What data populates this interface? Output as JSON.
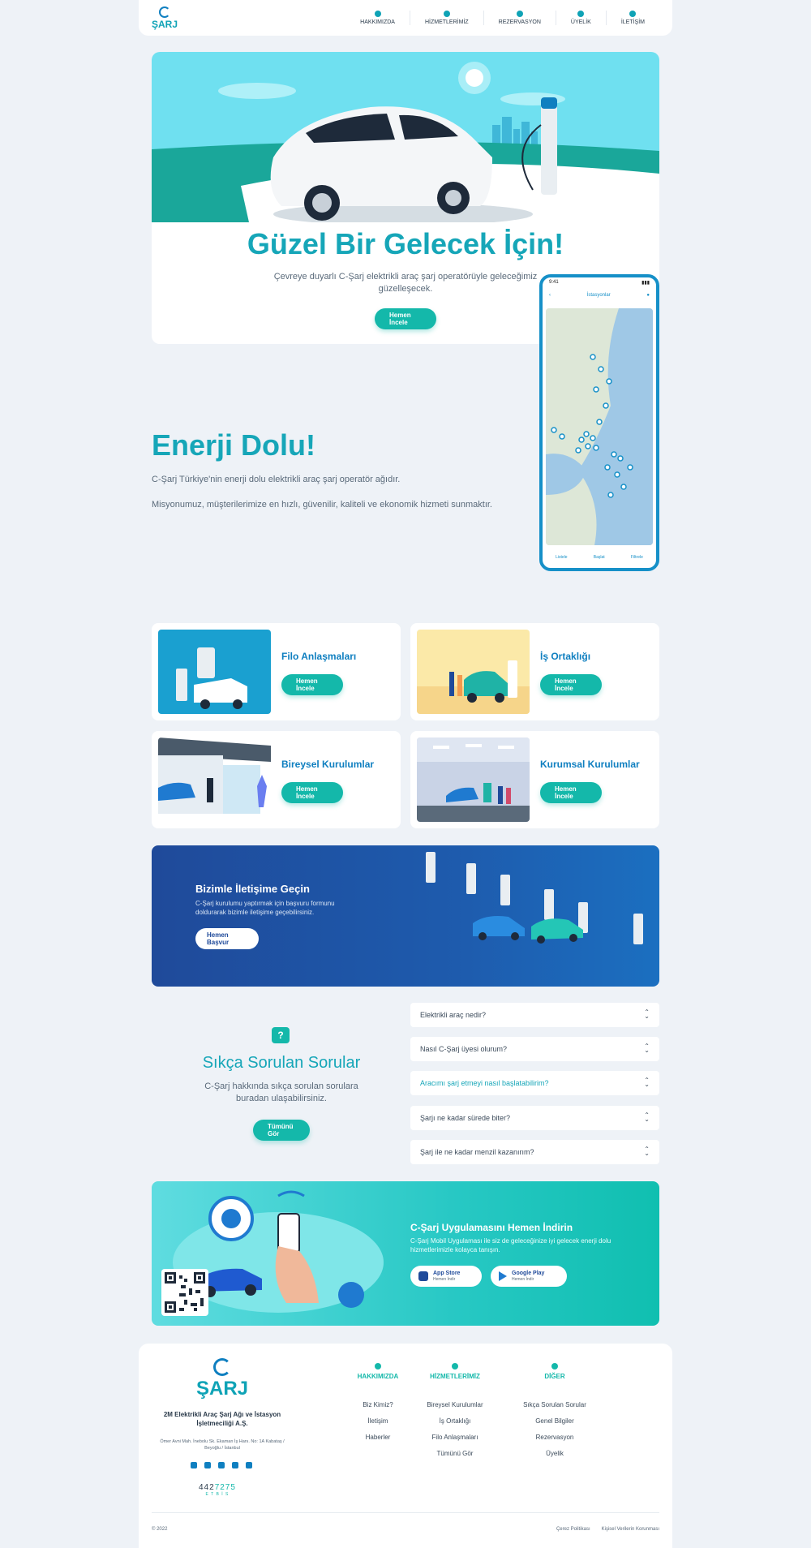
{
  "header": {
    "logo_text": "ŞARJ",
    "nav": [
      {
        "label": "HAKKIMIZDA",
        "icon": "cloud-icon"
      },
      {
        "label": "HİZMETLERİMİZ",
        "icon": "services-icon"
      },
      {
        "label": "REZERVASYON",
        "icon": "calendar-icon"
      },
      {
        "label": "ÜYELİK",
        "icon": "user-icon"
      },
      {
        "label": "İLETİŞİM",
        "icon": "mail-icon"
      }
    ]
  },
  "hero": {
    "title": "Güzel Bir Gelecek İçin!",
    "subtitle": "Çevreye duyarlı C-Şarj elektrikli araç şarj operatörüyle geleceğimiz güzelleşecek.",
    "button": "Hemen İncele"
  },
  "phone": {
    "time": "9:41",
    "screen_title": "İstasyonlar",
    "tabs": [
      "Listele",
      "Başlat",
      "Filtrele"
    ]
  },
  "energy": {
    "title": "Enerji Dolu!",
    "p1": "C-Şarj Türkiye'nin enerji dolu elektrikli araç şarj operatör ağıdır.",
    "p2": "Misyonumuz, müşterilerimize en hızlı, güvenilir, kaliteli ve ekonomik hizmeti sunmaktır."
  },
  "services": [
    {
      "title": "Filo Anlaşmaları",
      "button": "Hemen İncele"
    },
    {
      "title": "İş Ortaklığı",
      "button": "Hemen İncele"
    },
    {
      "title": "Bireysel Kurulumlar",
      "button": "Hemen İncele"
    },
    {
      "title": "Kurumsal Kurulumlar",
      "button": "Hemen İncele"
    }
  ],
  "contact": {
    "title": "Bizimle İletişime Geçin",
    "text": "C-Şarj kurulumu yaptırmak için başvuru formunu doldurarak bizimle iletişime geçebilirsiniz.",
    "button": "Hemen Başvur"
  },
  "faq": {
    "icon_glyph": "?",
    "title": "Sıkça Sorulan Sorular",
    "text": "C-Şarj hakkında sıkça sorulan sorulara buradan ulaşabilirsiniz.",
    "button": "Tümünü Gör",
    "items": [
      "Elektrikli araç nedir?",
      "Nasıl C-Şarj üyesi olurum?",
      "Aracımı şarj etmeyi nasıl başlatabilirim?",
      "Şarjı ne kadar sürede biter?",
      "Şarj ile ne kadar menzil kazanırım?"
    ],
    "active_index": 2
  },
  "app": {
    "title": "C-Şarj Uygulamasını Hemen İndirin",
    "text": "C-Şarj Mobil Uygulaması ile siz de geleceğinize iyi gelecek enerji dolu hizmetlerimizle kolayca tanışın.",
    "appstore_label": "App Store",
    "appstore_sub": "Hemen İndir",
    "googleplay_label": "Google Play",
    "googleplay_sub": "Hemen İndir"
  },
  "footer": {
    "logo_text": "ŞARJ",
    "company": "2M Elektrikli Araç Şarj Ağı ve İstasyon İşletmeciliği A.Ş.",
    "address": "Ömer Avni Mah. İnebolu Sk. Ekaman İş Hanı. No: 1A Kabataş / Beyoğlu / İstanbul",
    "etbis_number": "4427275",
    "etbis_black": "442",
    "etbis_teal": "7275",
    "etbis_label": "E T B İ S",
    "columns": [
      {
        "heading": "HAKKIMIZDA",
        "links": [
          "Biz Kimiz?",
          "İletişim",
          "Haberler"
        ]
      },
      {
        "heading": "HİZMETLERİMİZ",
        "links": [
          "Bireysel Kurulumlar",
          "İş Ortaklığı",
          "Filo Anlaşmaları",
          "Tümünü Gör"
        ]
      },
      {
        "heading": "DİĞER",
        "links": [
          "Sıkça Sorulan Sorular",
          "Genel Bilgiler",
          "Rezervasyon",
          "Üyelik"
        ]
      }
    ],
    "copyright": "© 2022",
    "legal": [
      "Çerez Politikası",
      "Kişisel Verilerin Korunması"
    ]
  },
  "colors": {
    "accent": "#16a6b8",
    "teal_button": "#14b8aa",
    "blue": "#0f7fc0",
    "contact_bg": "#1f4a9a",
    "page_bg": "#eef2f7"
  }
}
